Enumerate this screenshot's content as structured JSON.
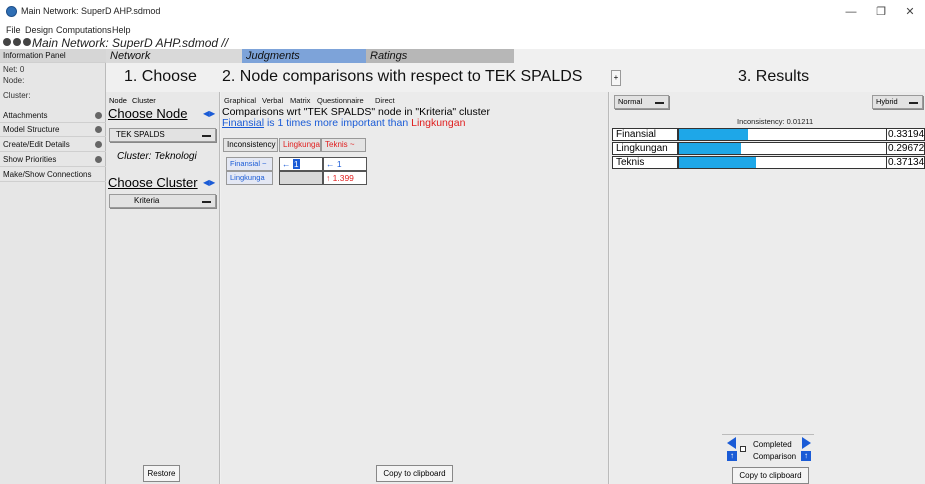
{
  "window": {
    "title": "Main Network: SuperD AHP.sdmod",
    "minimize_glyph": "—",
    "maximize_glyph": "❐",
    "close_glyph": "✕"
  },
  "menu": [
    "File",
    "Design",
    "Computations",
    "Help"
  ],
  "inner_frame": {
    "title": "Main Network: SuperD AHP.sdmod //"
  },
  "info_panel": {
    "header": "Information Panel",
    "net": "Net: 0",
    "node": "Node:",
    "cluster": "Cluster:",
    "items": [
      "Attachments",
      "Model Structure",
      "Create/Edit Details",
      "Show Priorities",
      "Make/Show Connections"
    ]
  },
  "tabs": [
    "Network",
    "Judgments",
    "Ratings"
  ],
  "section1": {
    "heading": "1. Choose",
    "subtabs": [
      "Node",
      "Cluster"
    ],
    "choose_node_label": "Choose Node",
    "node_value": "TEK SPALDS",
    "cluster_label": "Cluster: Teknologi",
    "choose_cluster_label": "Choose Cluster",
    "cluster_value": "Kriteria",
    "restore_label": "Restore"
  },
  "section2": {
    "heading": "2. Node comparisons with respect to TEK SPALDS",
    "plus_label": "+",
    "subtabs": [
      "Graphical",
      "Verbal",
      "Matrix",
      "Questionnaire",
      "Direct"
    ],
    "comparison_title": "Comparisons wrt \"TEK SPALDS\" node in \"Kriteria\" cluster",
    "comparison_left": "Finansial",
    "comparison_mid": "is 1 times more important than",
    "comparison_right": "Lingkungan",
    "inconsistency_btn": "Inconsistency",
    "col_headers": [
      "Lingkunga",
      "Teknis"
    ],
    "col_arrow": "~",
    "row_headers": [
      "Finansial ~",
      "Lingkunga"
    ],
    "cells": {
      "r1c1_arrow": "←",
      "r1c1_value": "1",
      "r1c2_arrow": "←",
      "r1c2_value": "1",
      "r2c2_arrow": "↑",
      "r2c2_value": "1.399"
    },
    "copy_label": "Copy to clipboard"
  },
  "section3": {
    "heading": "3. Results",
    "mode_left": "Normal",
    "mode_right": "Hybrid",
    "inconsistency": "Inconsistency: 0.01211",
    "results": [
      {
        "label": "Finansial",
        "value": "0.33194",
        "fraction": 0.33194
      },
      {
        "label": "Lingkungan",
        "value": "0.29672",
        "fraction": 0.29672
      },
      {
        "label": "Teknis",
        "value": "0.37134",
        "fraction": 0.37134
      }
    ],
    "completed_label": "Completed",
    "comparison_label": "Comparison",
    "copy_label": "Copy to clipboard"
  },
  "colors": {
    "accent_blue": "#1a5bd6",
    "bar_fill": "#1ea7e8",
    "red": "#e02020",
    "judgments_tab": "#7da3d9",
    "ratings_tab": "#b7b7b7"
  }
}
